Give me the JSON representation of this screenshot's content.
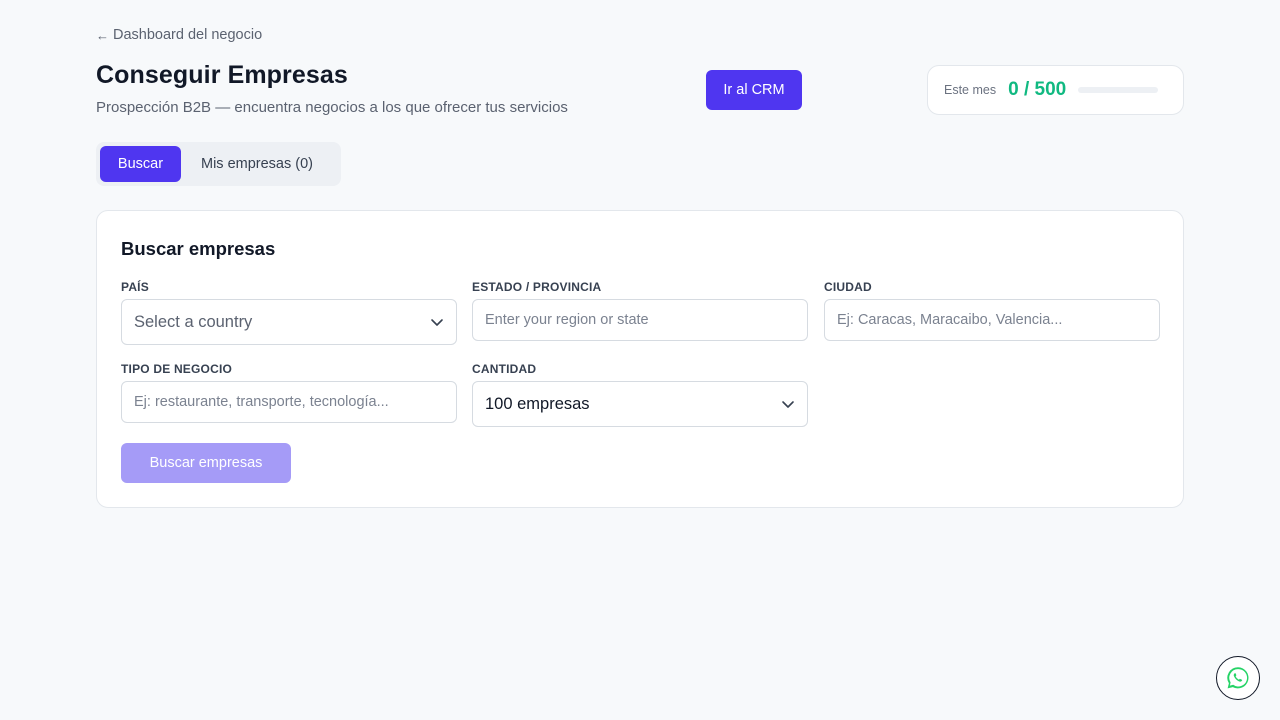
{
  "header": {
    "back_label": "Dashboard del negocio",
    "title": "Conseguir Empresas",
    "subtitle": "Prospección B2B — encuentra negocios a los que ofrecer tus servicios",
    "crm_button": "Ir al CRM"
  },
  "usage": {
    "label": "Este mes",
    "value": "0 / 500",
    "progress": 0
  },
  "tabs": [
    {
      "label": "Buscar",
      "active": true
    },
    {
      "label": "Mis empresas (0)",
      "active": false
    }
  ],
  "search": {
    "title": "Buscar empresas",
    "country": {
      "label": "PAÍS",
      "value": "Select a country"
    },
    "region": {
      "label": "ESTADO / PROVINCIA",
      "placeholder": "Enter your region or state"
    },
    "city": {
      "label": "CIUDAD",
      "placeholder": "Ej: Caracas, Maracaibo, Valencia..."
    },
    "business_type": {
      "label": "TIPO DE NEGOCIO",
      "placeholder": "Ej: restaurante, transporte, tecnología..."
    },
    "quantity": {
      "label": "CANTIDAD",
      "value": "100 empresas"
    },
    "submit_label": "Buscar empresas"
  },
  "colors": {
    "accent": "#4f36f0",
    "accent_disabled": "#a59bf7",
    "success": "#10b981",
    "whatsapp": "#25d366"
  },
  "icons": {
    "back": "arrow-left-icon",
    "select": "chevron-down-icon",
    "chat": "whatsapp-icon"
  }
}
